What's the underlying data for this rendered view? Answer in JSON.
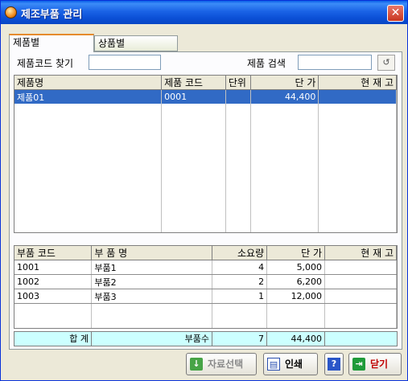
{
  "window": {
    "title": "제조부품 관리",
    "close_glyph": "✕"
  },
  "tabs": [
    {
      "label": "제품별",
      "active": true
    },
    {
      "label": "상품별",
      "active": false
    }
  ],
  "search": {
    "code_label": "제품코드 찾기",
    "code_value": "",
    "name_label": "제품 검색",
    "name_value": "",
    "refresh_icon": "refresh-icon"
  },
  "product_grid": {
    "headers": [
      "제품명",
      "제품 코드",
      "단위",
      "단 가",
      "현 재 고"
    ],
    "rows": [
      {
        "name": "제품01",
        "code": "0001",
        "unit": "",
        "price": "44,400",
        "stock": ""
      }
    ]
  },
  "parts_grid": {
    "headers": [
      "부품 코드",
      "부 품 명",
      "소요량",
      "단 가",
      "현 재 고"
    ],
    "rows": [
      {
        "code": "1001",
        "name": "부품1",
        "qty": "4",
        "price": "5,000",
        "stock": ""
      },
      {
        "code": "1002",
        "name": "부품2",
        "qty": "2",
        "price": "6,200",
        "stock": ""
      },
      {
        "code": "1003",
        "name": "부품3",
        "qty": "1",
        "price": "12,000",
        "stock": ""
      }
    ]
  },
  "totals": {
    "label": "합 계",
    "count_label": "부품수",
    "count": "7",
    "sum": "44,400"
  },
  "buttons": {
    "select": "자료선택",
    "print": "인쇄",
    "help": "?",
    "close": "닫기"
  },
  "colors": {
    "title_bar": "#0b4fd6",
    "selection": "#316ac5",
    "total_row": "#ccffff"
  }
}
